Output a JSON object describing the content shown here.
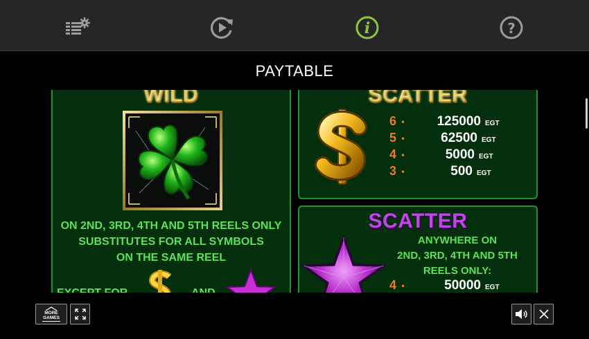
{
  "topbar": {
    "icons": [
      "settings-icon",
      "autoplay-icon",
      "info-icon",
      "help-icon"
    ],
    "active_color": "#8cc63f"
  },
  "title": "PAYTABLE",
  "wild": {
    "header": "WILD",
    "symbol": "four-leaf-clover",
    "description_lines": [
      "ON 2ND, 3RD, 4TH AND 5TH REELS ONLY",
      "SUBSTITUTES FOR ALL SYMBOLS",
      "ON THE SAME REEL"
    ],
    "except_text": "EXCEPT FOR",
    "and_text": "AND"
  },
  "scatter_dollar": {
    "header": "SCATTER",
    "symbol": "dollar-sign",
    "pays": [
      {
        "count": "6",
        "amount": "125000",
        "currency": "EGT"
      },
      {
        "count": "5",
        "amount": "62500",
        "currency": "EGT"
      },
      {
        "count": "4",
        "amount": "5000",
        "currency": "EGT"
      },
      {
        "count": "3",
        "amount": "500",
        "currency": "EGT"
      }
    ]
  },
  "scatter_star": {
    "header": "SCATTER",
    "symbol": "purple-star",
    "note_lines": [
      "ANYWHERE ON",
      "2ND, 3RD, 4TH AND 5TH",
      "REELS ONLY:"
    ],
    "pays": [
      {
        "count": "4",
        "amount": "50000",
        "currency": "EGT"
      }
    ]
  },
  "bottombar": {
    "more_games_line1": "MORE",
    "more_games_line2": "GAMES"
  },
  "colors": {
    "panel_bg": "#042f0d",
    "panel_border": "#24922f",
    "gold": "#f5c63a",
    "purple": "#c046e6",
    "green_text": "#5ee05a",
    "count_orange": "#ee7a2b"
  }
}
